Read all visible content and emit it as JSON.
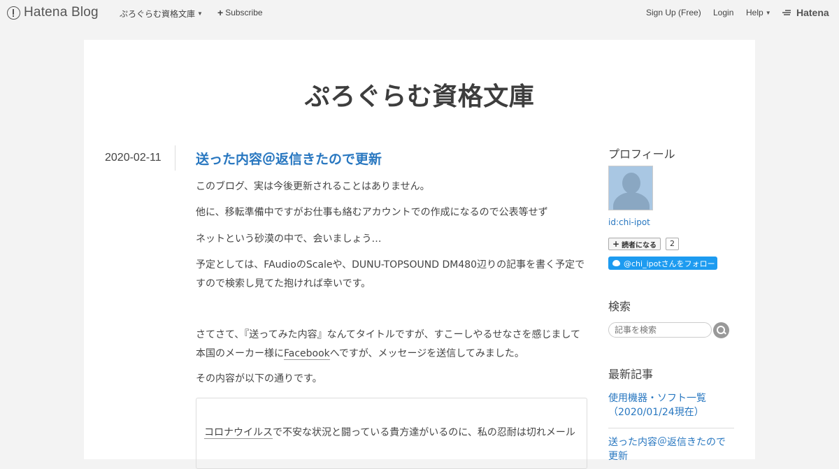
{
  "topbar": {
    "logo_text": "Hatena Blog",
    "blog_menu_label": "ぷろぐらむ資格文庫",
    "subscribe_label": "Subscribe",
    "signup_label": "Sign Up (Free)",
    "login_label": "Login",
    "help_label": "Help",
    "hatena_label": "Hatena"
  },
  "blog": {
    "title": "ぷろぐらむ資格文庫"
  },
  "entry": {
    "date": "2020-02-11",
    "title": "送った内容＠返信きたので更新",
    "paragraphs": [
      "このブログ、実は今後更新されることはありません。",
      "他に、移転準備中ですがお仕事も絡むアカウントでの作成になるので公表等せず",
      "ネットという砂漠の中で、会いましょう…",
      "予定としては、FAudioのScaleや、DUNU-TOPSOUND DM480辺りの記事を書く予定ですので検索し見てた抱ければ幸いです。",
      "さてさて、『送ってみた内容』なんてタイトルですが、すこーしやるせなさを感じまして",
      "本国のメーカー様に",
      "Facebook",
      "へですが、メッセージを送信してみました。",
      "その内容が以下の通りです。"
    ],
    "quote_link": "コロナウイルス",
    "quote_rest": "で不安な状況と闘っている貴方達がいるのに、私の忍耐は切れメール"
  },
  "sidebar": {
    "profile_heading": "プロフィール",
    "user_id": "id:chi-ipot",
    "reader_button": "読者になる",
    "reader_count": "2",
    "follow_button": "@chi_ipotさんをフォロー",
    "search_heading": "検索",
    "search_placeholder": "記事を検索",
    "recent_heading": "最新記事",
    "recent_items": [
      "使用機器・ソフト一覧（2020/01/24現在）",
      "送った内容＠返信きたので更新"
    ]
  },
  "colors": {
    "link": "#2877c0",
    "twitter": "#1d9bf0",
    "background": "#f3f3f3"
  }
}
